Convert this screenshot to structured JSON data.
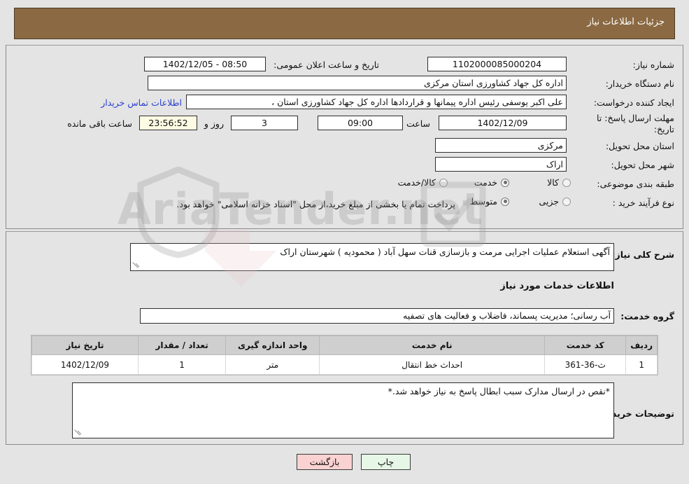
{
  "header": {
    "title": "جزئیات اطلاعات نیاز"
  },
  "top_form": {
    "need_number_label": "شماره نیاز:",
    "need_number_value": "1102000085000204",
    "announce_datetime_label": "تاریخ و ساعت اعلان عمومی:",
    "announce_datetime_value": "08:50 - 1402/12/05",
    "buyer_org_label": "نام دستگاه خریدار:",
    "buyer_org_value": "اداره کل جهاد کشاورزی استان مرکزی",
    "creator_label": "ایجاد کننده درخواست:",
    "creator_value": "علی اکبر یوسفی رئیس اداره پیمانها و قراردادها اداره کل جهاد کشاورزی استان ،",
    "contact_link": "اطلاعات تماس خریدار",
    "deadline_label": "مهلت ارسال پاسخ: تا تاریخ:",
    "deadline_date": "1402/12/09",
    "deadline_hour_label": "ساعت",
    "deadline_hour": "09:00",
    "remaining_days": "3",
    "remaining_days_label": "روز و",
    "remaining_time": "23:56:52",
    "remaining_time_label": "ساعت باقی مانده",
    "province_label": "استان محل تحویل:",
    "province_value": "مرکزی",
    "city_label": "شهر محل تحویل:",
    "city_value": "اراک",
    "category_label": "طبقه بندی موضوعی:",
    "category_options": [
      {
        "label": "کالا",
        "selected": false
      },
      {
        "label": "خدمت",
        "selected": true
      },
      {
        "label": "کالا/خدمت",
        "selected": false
      }
    ],
    "process_label": "نوع فرآیند خرید :",
    "process_options": [
      {
        "label": "جزیی",
        "selected": false
      },
      {
        "label": "متوسط",
        "selected": true
      }
    ],
    "treasury_note": "پرداخت تمام یا بخشی از مبلغ خرید،از محل \"اسناد خزانه اسلامی\" خواهد بود."
  },
  "middle": {
    "need_summary_label": "شرح کلی نیاز:",
    "need_summary_value": "آگهی استعلام عملیات اجرایی مرمت و بازسازی قنات سهل آباد ( محمودیه ) شهرستان اراک",
    "services_section_title": "اطلاعات خدمات مورد نیاز",
    "service_group_label": "گروه خدمت:",
    "service_group_value": "آب رسانی؛ مدیریت پسماند، فاضلاب و فعالیت های تصفیه",
    "table": {
      "columns": [
        "ردیف",
        "کد خدمت",
        "نام خدمت",
        "واحد اندازه گیری",
        "تعداد / مقدار",
        "تاریخ نیاز"
      ],
      "rows": [
        [
          "1",
          "ث-36-361",
          "احداث خط انتقال",
          "متر",
          "1",
          "1402/12/09"
        ]
      ]
    },
    "buyer_notes_label": "توضیحات خریدار:",
    "buyer_notes_value": "*نقص در ارسال مدارک سبب ابطال پاسخ به نیاز خواهد شد.*"
  },
  "footer": {
    "print_label": "چاپ",
    "back_label": "بازگشت"
  },
  "watermark": {
    "text": "AriaTender.net"
  },
  "colors": {
    "header_bg": "#8b6a43",
    "page_bg": "#e4e4e4",
    "link": "#2a3fcf",
    "print_btn": "#e7f7e7",
    "back_btn": "#fbd2d2",
    "timer_bg": "#fdfbe4"
  }
}
